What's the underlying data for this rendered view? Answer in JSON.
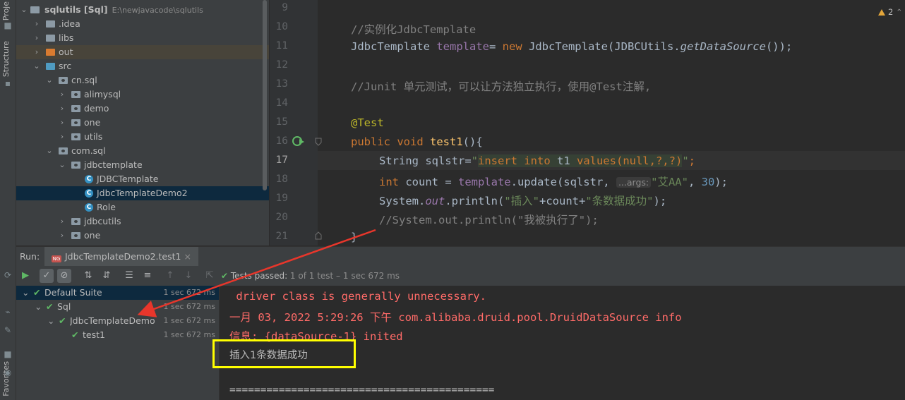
{
  "left_strip": {
    "project_tab": "Proje",
    "structure_tab": "Structure",
    "favorites_tab": "Favorites"
  },
  "project_tree": [
    {
      "label": "sqlutils [Sql]",
      "path": "E:\\newjavacode\\sqlutils",
      "kind": "module",
      "depth": 0,
      "expanded": true
    },
    {
      "label": ".idea",
      "kind": "folder",
      "depth": 1,
      "expanded": false
    },
    {
      "label": "libs",
      "kind": "folder",
      "depth": 1,
      "expanded": false
    },
    {
      "label": "out",
      "kind": "folder-orange",
      "depth": 1,
      "expanded": false,
      "highlight": true
    },
    {
      "label": "src",
      "kind": "folder-blue",
      "depth": 1,
      "expanded": true
    },
    {
      "label": "cn.sql",
      "kind": "package",
      "depth": 2,
      "expanded": true
    },
    {
      "label": "alimysql",
      "kind": "package",
      "depth": 3,
      "expanded": false
    },
    {
      "label": "demo",
      "kind": "package",
      "depth": 3,
      "expanded": false
    },
    {
      "label": "one",
      "kind": "package",
      "depth": 3,
      "expanded": false
    },
    {
      "label": "utils",
      "kind": "package",
      "depth": 3,
      "expanded": false
    },
    {
      "label": "com.sql",
      "kind": "package",
      "depth": 2,
      "expanded": true
    },
    {
      "label": "jdbctemplate",
      "kind": "package",
      "depth": 3,
      "expanded": true
    },
    {
      "label": "JDBCTemplate",
      "kind": "class",
      "depth": 4
    },
    {
      "label": "JdbcTemplateDemo2",
      "kind": "class",
      "depth": 4,
      "selected": true
    },
    {
      "label": "Role",
      "kind": "class",
      "depth": 4
    },
    {
      "label": "jdbcutils",
      "kind": "package",
      "depth": 3,
      "expanded": false
    },
    {
      "label": "one",
      "kind": "package",
      "depth": 3,
      "expanded": false
    }
  ],
  "editor": {
    "warning_count": "2",
    "line_numbers": [
      "9",
      "10",
      "11",
      "12",
      "13",
      "14",
      "15",
      "16",
      "17",
      "18",
      "19",
      "20",
      "21"
    ],
    "current_line": "17",
    "l10_comment": "//实例化JdbcTemplate",
    "l11_type": "JdbcTemplate ",
    "l11_var": "template",
    "l11_eq": "= ",
    "l11_new": "new ",
    "l11_rest1": "JdbcTemplate(JDBCUtils.",
    "l11_method": "getDataSource",
    "l11_rest2": "());",
    "l13_comment": "//Junit 单元测试，可以让方法独立执行，使用@Test注解,",
    "l15_annotation": "@Test",
    "l16_public": "public ",
    "l16_void": "void ",
    "l16_name": "test1",
    "l16_rest": "(){",
    "l17_a": "String sqlstr=",
    "l17_q1": "\"",
    "l17_sql_kw1": "insert into ",
    "l17_sql_tbl": "t1 ",
    "l17_sql_kw2": "values",
    "l17_sql_args": "(null,?,?)",
    "l17_q2": "\"",
    "l17_end": ";",
    "l18_int": "int ",
    "l18_a": "count = ",
    "l18_var": "template",
    "l18_b": ".update(sqlstr, ",
    "l18_hint": "...args:",
    "l18_str": "\"艾AA\"",
    "l18_c": ", ",
    "l18_num": "30",
    "l18_d": ");",
    "l19_a": "System.",
    "l19_out": "out",
    "l19_b": ".println(",
    "l19_s1": "\"插入\"",
    "l19_c": "+count+",
    "l19_s2": "\"条数据成功\"",
    "l19_d": ");",
    "l20_comment": "//System.out.println(\"我被执行了\");",
    "l21_brace": "}"
  },
  "run": {
    "label": "Run:",
    "tab": "JdbcTemplateDemo2.test1",
    "tab_icon": "NG",
    "passed_bold": "Tests passed: ",
    "passed_detail": "1 of 1 test – 1 sec 672 ms"
  },
  "test_tree": [
    {
      "label": "Default Suite",
      "time": "1 sec 672 ms",
      "depth": 0,
      "selected": true
    },
    {
      "label": "Sql",
      "time": "1 sec 672 ms",
      "depth": 1
    },
    {
      "label": "JdbcTemplateDemo",
      "time": "1 sec 672 ms",
      "depth": 2
    },
    {
      "label": "test1",
      "time": "1 sec 672 ms",
      "depth": 3
    }
  ],
  "console": {
    "line1": " driver class is generally unnecessary.",
    "line2": "一月 03, 2022 5:29:26 下午 com.alibaba.druid.pool.DruidDataSource info",
    "line3": "信息: {dataSource-1} inited",
    "line4": "插入1条数据成功",
    "line5": "==========================================="
  },
  "colors": {
    "annotation_box": "#ffff00",
    "arrow": "#e8362b",
    "error_text": "#ff6b68",
    "pass_green": "#5fb865"
  }
}
